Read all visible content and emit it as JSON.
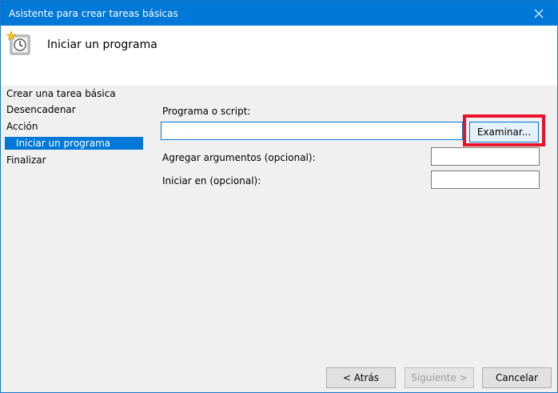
{
  "window": {
    "title": "Asistente para crear tareas básicas",
    "close_icon": "close-icon"
  },
  "header": {
    "icon": "task-scheduler-icon",
    "title": "Iniciar un programa"
  },
  "sidebar": {
    "items": [
      {
        "label": "Crear una tarea básica"
      },
      {
        "label": "Desencadenar"
      },
      {
        "label": "Acción"
      },
      {
        "label": "Iniciar un programa"
      },
      {
        "label": "Finalizar"
      }
    ],
    "selected": "Iniciar un programa"
  },
  "form": {
    "program_label": "Programa o script:",
    "program_value": "",
    "browse_label": "Examinar...",
    "args_label": "Agregar argumentos (opcional):",
    "args_value": "",
    "start_in_label": "Iniciar en (opcional):",
    "start_in_value": ""
  },
  "footer": {
    "back_label": "< Atrás",
    "next_label": "Siguiente >",
    "cancel_label": "Cancelar"
  },
  "colors": {
    "accent": "#0078d7",
    "highlight": "#e8122a"
  }
}
